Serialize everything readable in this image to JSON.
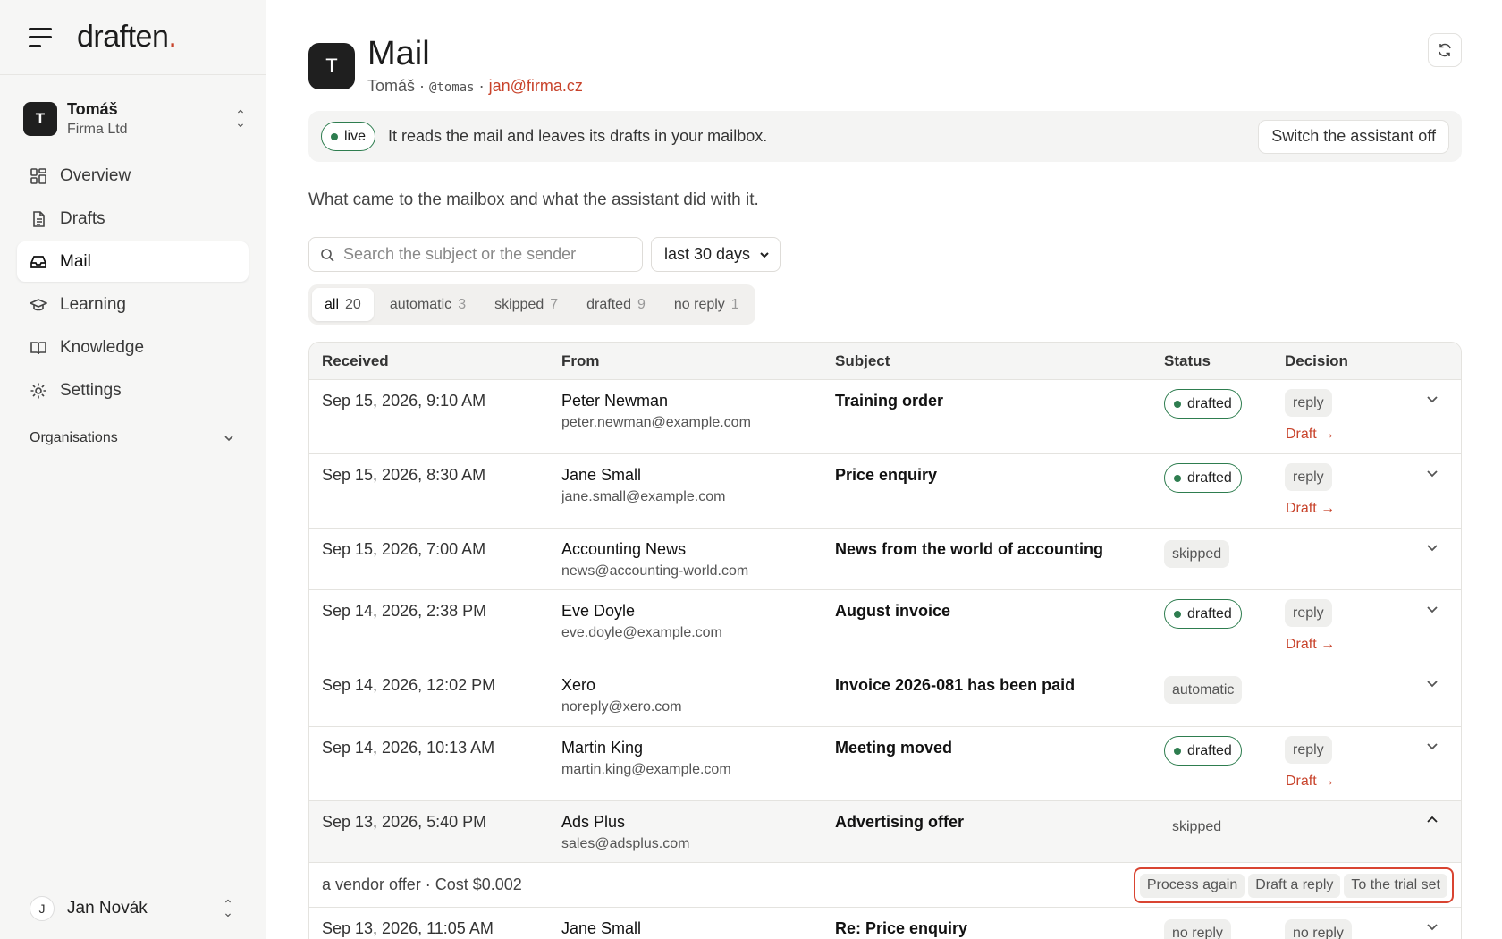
{
  "brand": {
    "name": "draften",
    "dot": "."
  },
  "account": {
    "initial": "T",
    "name": "Tomáš",
    "org": "Firma Ltd"
  },
  "nav": [
    {
      "label": "Overview",
      "icon": "grid-icon"
    },
    {
      "label": "Drafts",
      "icon": "document-icon"
    },
    {
      "label": "Mail",
      "icon": "inbox-icon",
      "active": true
    },
    {
      "label": "Learning",
      "icon": "graduation-cap-icon"
    },
    {
      "label": "Knowledge",
      "icon": "book-icon"
    },
    {
      "label": "Settings",
      "icon": "gear-icon"
    }
  ],
  "organisations_label": "Organisations",
  "user": {
    "initial": "J",
    "name": "Jan Novák"
  },
  "header": {
    "initial": "T",
    "title": "Mail",
    "name": "Tomáš",
    "sep1": " · ",
    "handle": "@tomas",
    "sep2": " · ",
    "email": "jan@firma.cz"
  },
  "live": {
    "badge": "live",
    "text": "It reads the mail and leaves its drafts in your mailbox.",
    "switch_label": "Switch the assistant off"
  },
  "description": "What came to the mailbox and what the assistant did with it.",
  "search": {
    "placeholder": "Search the subject or the sender"
  },
  "period": {
    "selected": "last 30 days"
  },
  "tabs": [
    {
      "label": "all",
      "count": "20",
      "active": true
    },
    {
      "label": "automatic",
      "count": "3"
    },
    {
      "label": "skipped",
      "count": "7"
    },
    {
      "label": "drafted",
      "count": "9"
    },
    {
      "label": "no reply",
      "count": "1"
    }
  ],
  "table": {
    "headers": {
      "received": "Received",
      "from": "From",
      "subject": "Subject",
      "status": "Status",
      "decision": "Decision"
    },
    "rows": [
      {
        "received": "Sep 15, 2026, 9:10 AM",
        "from_name": "Peter Newman",
        "from_email": "peter.newman@example.com",
        "subject": "Training order",
        "status": "drafted",
        "decision": "reply",
        "draft_link": "Draft →"
      },
      {
        "received": "Sep 15, 2026, 8:30 AM",
        "from_name": "Jane Small",
        "from_email": "jane.small@example.com",
        "subject": "Price enquiry",
        "status": "drafted",
        "decision": "reply",
        "draft_link": "Draft →"
      },
      {
        "received": "Sep 15, 2026, 7:00 AM",
        "from_name": "Accounting News",
        "from_email": "news@accounting-world.com",
        "subject": "News from the world of accounting",
        "status": "skipped"
      },
      {
        "received": "Sep 14, 2026, 2:38 PM",
        "from_name": "Eve Doyle",
        "from_email": "eve.doyle@example.com",
        "subject": "August invoice",
        "status": "drafted",
        "decision": "reply",
        "draft_link": "Draft →"
      },
      {
        "received": "Sep 14, 2026, 12:02 PM",
        "from_name": "Xero",
        "from_email": "noreply@xero.com",
        "subject": "Invoice 2026-081 has been paid",
        "status": "automatic"
      },
      {
        "received": "Sep 14, 2026, 10:13 AM",
        "from_name": "Martin King",
        "from_email": "martin.king@example.com",
        "subject": "Meeting moved",
        "status": "drafted",
        "decision": "reply",
        "draft_link": "Draft →"
      },
      {
        "received": "Sep 13, 2026, 5:40 PM",
        "from_name": "Ads Plus",
        "from_email": "sales@adsplus.com",
        "subject": "Advertising offer",
        "status": "skipped",
        "expanded": true
      },
      {
        "received": "Sep 13, 2026, 11:05 AM",
        "from_name": "Jane Small",
        "from_email": "",
        "subject": "Re: Price enquiry",
        "status": "no reply",
        "decision": "no reply"
      }
    ],
    "detail": {
      "text": "a vendor offer · Cost $0.002",
      "actions": [
        "Process again",
        "Draft a reply",
        "To the trial set"
      ]
    }
  },
  "colors": {
    "accent": "#c8432b",
    "live_green": "#2e7d4f",
    "highlight_red": "#d94431"
  }
}
